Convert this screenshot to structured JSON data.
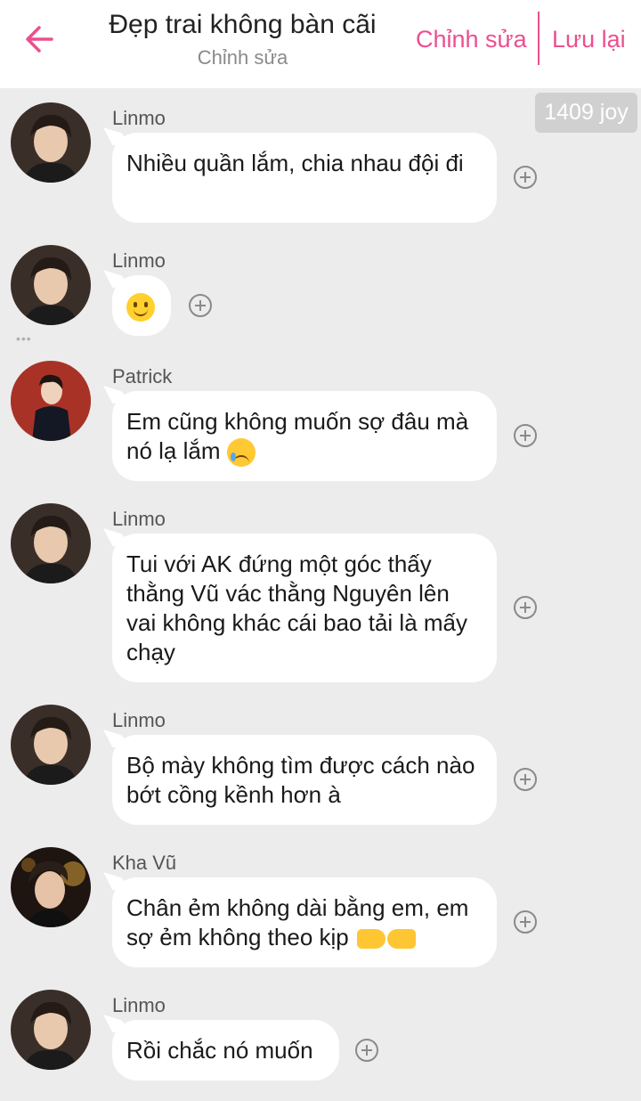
{
  "header": {
    "title": "Đẹp trai không bàn cãi",
    "subtitle": "Chỉnh sửa",
    "edit_label": "Chỉnh sửa",
    "save_label": "Lưu lại",
    "accent_color": "#ec4f8e"
  },
  "watermark": "1409 joy",
  "messages": [
    {
      "sender": "Linmo",
      "text": "Nhiều quần lắm, chia nhau đội đi"
    },
    {
      "sender": "Linmo",
      "text": ""
    },
    {
      "sender": "Patrick",
      "text": "Em cũng không muốn sợ đâu mà nó lạ lắm"
    },
    {
      "sender": "Linmo",
      "text": "Tui với AK đứng một góc thấy thằng Vũ vác thằng Nguyên lên vai không khác cái bao tải là mấy chạy"
    },
    {
      "sender": "Linmo",
      "text": "Bộ mày không tìm được cách nào bớt cồng kềnh hơn à"
    },
    {
      "sender": "Kha Vũ",
      "text": "Chân ẻm không dài bằng em, em sợ ẻm không theo kịp"
    },
    {
      "sender": "Linmo",
      "text": "Rồi chắc nó muốn"
    }
  ],
  "icons": {
    "back": "arrow-left-icon",
    "add_reaction": "plus-circle-icon",
    "emoji_smile": "slightly-smiling-face-emoji",
    "emoji_sad": "sad-but-relieved-face-emoji",
    "emoji_point_right": "backhand-index-pointing-right-emoji",
    "emoji_point_left": "backhand-index-pointing-left-emoji"
  }
}
